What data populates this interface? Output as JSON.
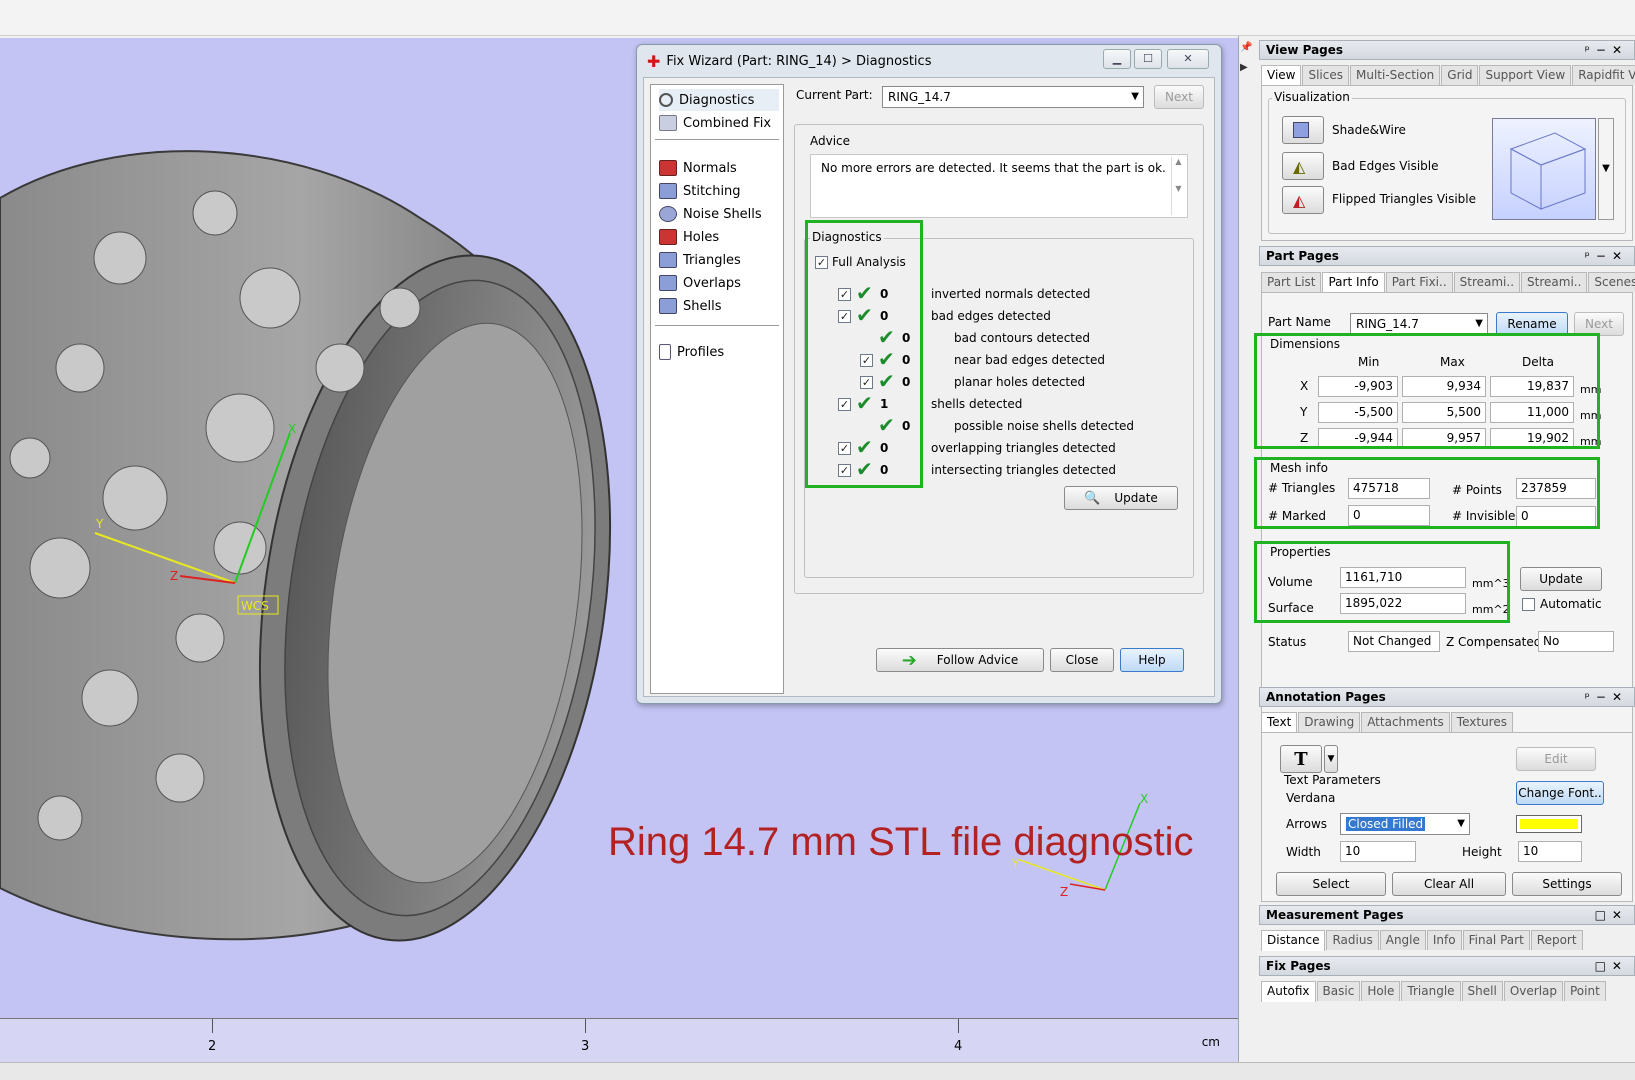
{
  "viewport": {
    "overlay_title": "Ring 14.7 mm STL file diagnostic",
    "wcs_label": "WCS",
    "axis_x": "X",
    "axis_y": "Y",
    "axis_z": "Z",
    "ruler": {
      "labels": [
        "2",
        "3",
        "4"
      ],
      "unit": "cm"
    },
    "background_color": "#c4c4f4"
  },
  "wizard": {
    "title": "Fix Wizard (Part: RING_14) > Diagnostics",
    "nav": {
      "diagnostics": "Diagnostics",
      "combined_fix": "Combined Fix",
      "normals": "Normals",
      "stitching": "Stitching",
      "noise_shells": "Noise Shells",
      "holes": "Holes",
      "triangles": "Triangles",
      "overlaps": "Overlaps",
      "shells": "Shells",
      "profiles": "Profiles"
    },
    "current_part_label": "Current Part:",
    "current_part_value": "RING_14.7",
    "next_label": "Next",
    "advice_title": "Advice",
    "advice_text": "No more errors are detected. It seems that the part is ok.",
    "diagnostics_title": "Diagnostics",
    "full_analysis": "Full Analysis",
    "rows": [
      {
        "count": "0",
        "text": "inverted normals detected"
      },
      {
        "count": "0",
        "text": "bad edges detected"
      },
      {
        "count": "0",
        "text": "bad contours detected"
      },
      {
        "count": "0",
        "text": "near bad edges detected"
      },
      {
        "count": "0",
        "text": "planar holes detected"
      },
      {
        "count": "1",
        "text": "shells detected"
      },
      {
        "count": "0",
        "text": "possible noise shells detected"
      },
      {
        "count": "0",
        "text": "overlapping triangles detected"
      },
      {
        "count": "0",
        "text": "intersecting triangles detected"
      }
    ],
    "update_label": "Update",
    "follow_advice_label": "Follow Advice",
    "close_label": "Close",
    "help_label": "Help"
  },
  "view_pages": {
    "title": "View Pages",
    "tabs": [
      "View",
      "Slices",
      "Multi-Section",
      "Grid",
      "Support View",
      "Rapidfit View"
    ],
    "visualization_title": "Visualization",
    "shade_wire": "Shade&Wire",
    "bad_edges": "Bad Edges Visible",
    "flipped": "Flipped Triangles Visible"
  },
  "part_pages": {
    "title": "Part Pages",
    "tabs": [
      "Part List",
      "Part Info",
      "Part Fixi..",
      "Streami..",
      "Streami..",
      "Scenes"
    ],
    "part_name_label": "Part Name",
    "part_name_value": "RING_14.7",
    "rename_label": "Rename",
    "next_label": "Next",
    "dimensions_title": "Dimensions",
    "col_min": "Min",
    "col_max": "Max",
    "col_delta": "Delta",
    "x": {
      "label": "X",
      "min": "-9,903",
      "max": "9,934",
      "delta": "19,837",
      "unit": "mm"
    },
    "y": {
      "label": "Y",
      "min": "-5,500",
      "max": "5,500",
      "delta": "11,000",
      "unit": "mm"
    },
    "z": {
      "label": "Z",
      "min": "-9,944",
      "max": "9,957",
      "delta": "19,902",
      "unit": "mm"
    },
    "mesh_title": "Mesh info",
    "triangles_label": "# Triangles",
    "triangles_value": "475718",
    "points_label": "# Points",
    "points_value": "237859",
    "marked_label": "# Marked",
    "marked_value": "0",
    "invisible_label": "# Invisible",
    "invisible_value": "0",
    "properties_title": "Properties",
    "volume_label": "Volume",
    "volume_value": "1161,710",
    "volume_unit": "mm^3",
    "surface_label": "Surface",
    "surface_value": "1895,022",
    "surface_unit": "mm^2",
    "update_label": "Update",
    "automatic_label": "Automatic",
    "status_label": "Status",
    "status_value": "Not Changed",
    "zcomp_label": "Z Compensated",
    "zcomp_value": "No"
  },
  "annotation_pages": {
    "title": "Annotation Pages",
    "tabs": [
      "Text",
      "Drawing",
      "Attachments",
      "Textures"
    ],
    "text_tool": "T",
    "edit_label": "Edit",
    "text_params_title": "Text Parameters",
    "font_value": "Verdana",
    "change_font_label": "Change Font..",
    "arrows_label": "Arrows",
    "arrows_value": "Closed Filled",
    "arrow_color": "#ffff00",
    "width_label": "Width",
    "width_value": "10",
    "height_label": "Height",
    "height_value": "10",
    "select_label": "Select",
    "clear_all_label": "Clear All",
    "settings_label": "Settings"
  },
  "measurement_pages": {
    "title": "Measurement Pages",
    "tabs": [
      "Distance",
      "Radius",
      "Angle",
      "Info",
      "Final Part",
      "Report"
    ]
  },
  "fix_pages": {
    "title": "Fix Pages",
    "tabs": [
      "Autofix",
      "Basic",
      "Hole",
      "Triangle",
      "Shell",
      "Overlap",
      "Point"
    ]
  },
  "colors": {
    "highlight": "#1fb31f",
    "check": "#1c8c2c",
    "title_red": "#b22222"
  }
}
